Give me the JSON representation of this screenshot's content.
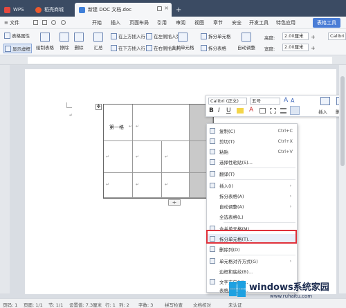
{
  "tabs": [
    {
      "label": "WPS",
      "color": "#e4493f"
    },
    {
      "label": "稻壳商城",
      "color": "#ec5a2d"
    },
    {
      "label": "新建 DOC 文档.doc",
      "color": "#3f7fd8"
    }
  ],
  "tab_add": "+",
  "menu": {
    "file": "≡ 文件",
    "items": [
      "开始",
      "插入",
      "页面布局",
      "引用",
      "审阅",
      "视图",
      "章节",
      "安全",
      "开发工具",
      "特色应用"
    ],
    "active_tab": "表格工具"
  },
  "toolbar": {
    "table_props": "表格属性",
    "show_gridlines": "显示虚框",
    "draw_table": "绘制表格",
    "erase": "擦除",
    "delete": "删除",
    "summary": "汇总",
    "insert_above": "在上方插入行",
    "insert_below": "在下方插入行",
    "insert_left": "在左侧插入列",
    "insert_right": "在右侧插入列",
    "merge_cells": "合并单元格",
    "split_cells": "拆分单元格",
    "split_table": "拆分表格",
    "auto_fit": "自动调整",
    "height_label": "高度:",
    "height_value": "2.00厘米",
    "width_label": "宽度:",
    "width_value": "2.00厘米",
    "font_name": "Calibri"
  },
  "table": {
    "first_cell": "第一格",
    "return_mark": "↵",
    "add_row": "+"
  },
  "page_return_mark": "↵",
  "mini_toolbar": {
    "font": "Calibri (正文)",
    "size": "五号",
    "bold": "B",
    "italic": "I",
    "underline": "U",
    "insert": "插入",
    "delete": "删除"
  },
  "context_menu": [
    {
      "label": "复制(C)",
      "shortcut": "Ctrl+C",
      "icon": "copy-icon"
    },
    {
      "label": "剪切(T)",
      "shortcut": "Ctrl+X",
      "icon": "cut-icon"
    },
    {
      "label": "粘贴",
      "shortcut": "Ctrl+V",
      "icon": "paste-icon"
    },
    {
      "label": "选择性粘贴(S)...",
      "shortcut": "",
      "icon": "paste-special-icon"
    },
    {
      "label": "翻译(T)",
      "shortcut": "",
      "icon": "translate-icon"
    },
    {
      "label": "插入(I)",
      "shortcut": "",
      "icon": "insert-icon",
      "submenu": true
    },
    {
      "label": "拆分表格(A)",
      "shortcut": "",
      "icon": "",
      "submenu": true
    },
    {
      "label": "自动调整(A)",
      "shortcut": "",
      "icon": "",
      "submenu": true
    },
    {
      "label": "全选表格(L)",
      "shortcut": "",
      "icon": ""
    },
    {
      "label": "合并单元格(M)",
      "shortcut": "",
      "icon": "merge-icon"
    },
    {
      "label": "拆分单元格(T)...",
      "shortcut": "",
      "icon": "split-icon"
    },
    {
      "label": "删除列(D)",
      "shortcut": "",
      "icon": "delete-column-icon"
    },
    {
      "label": "单元格对齐方式(G)",
      "shortcut": "",
      "icon": "align-icon",
      "submenu": true
    },
    {
      "label": "边框和底纹(B)...",
      "shortcut": "",
      "icon": ""
    },
    {
      "label": "文字方向(X)...",
      "shortcut": "",
      "icon": "text-direction-icon"
    },
    {
      "label": "表格属性(R)...",
      "shortcut": "",
      "icon": ""
    }
  ],
  "status": {
    "page_num": "页码: 1",
    "pages": "页面: 1/1",
    "section": "节: 1/1",
    "position": "设置值: 7.3厘米",
    "row": "行: 1",
    "col": "列: 2",
    "words": "字数: 3",
    "spell": "拼写检查",
    "proof": "文档校对",
    "unsaved": "未认证"
  },
  "watermark": {
    "brand": "windows系统家园",
    "url": "www.ruhaitu.com"
  }
}
